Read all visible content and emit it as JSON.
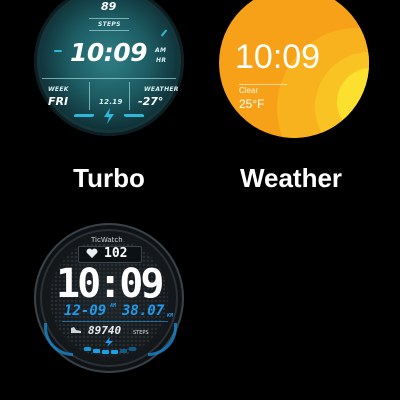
{
  "faces": [
    {
      "name": "Turbo",
      "steps_value": "89",
      "steps_label": "STEPS",
      "time": "10:09",
      "ampm": "AM",
      "hr": "HR",
      "week_label": "WEEK",
      "day": "FRI",
      "date": "12.19",
      "weather_label": "WEATHER",
      "temp": "-27°"
    },
    {
      "name": "Weather",
      "time": "10:09",
      "condition": "Clear",
      "temp": "25°F"
    },
    {
      "brand": "TicWatch",
      "heart_rate": "102",
      "time": "10:09",
      "date": "12-09",
      "ampm": "AM",
      "distance": "38.07",
      "distance_unit": "KM",
      "steps": "89740",
      "steps_label": "STEPS"
    }
  ],
  "colors": {
    "background": "#000000",
    "turbo_teal": "#1d5b62",
    "turbo_accent": "#2fb7d9",
    "weather_orange": "#f6a117",
    "weather_sun": "#fbe030",
    "tic_blue": "#1c9df0"
  }
}
